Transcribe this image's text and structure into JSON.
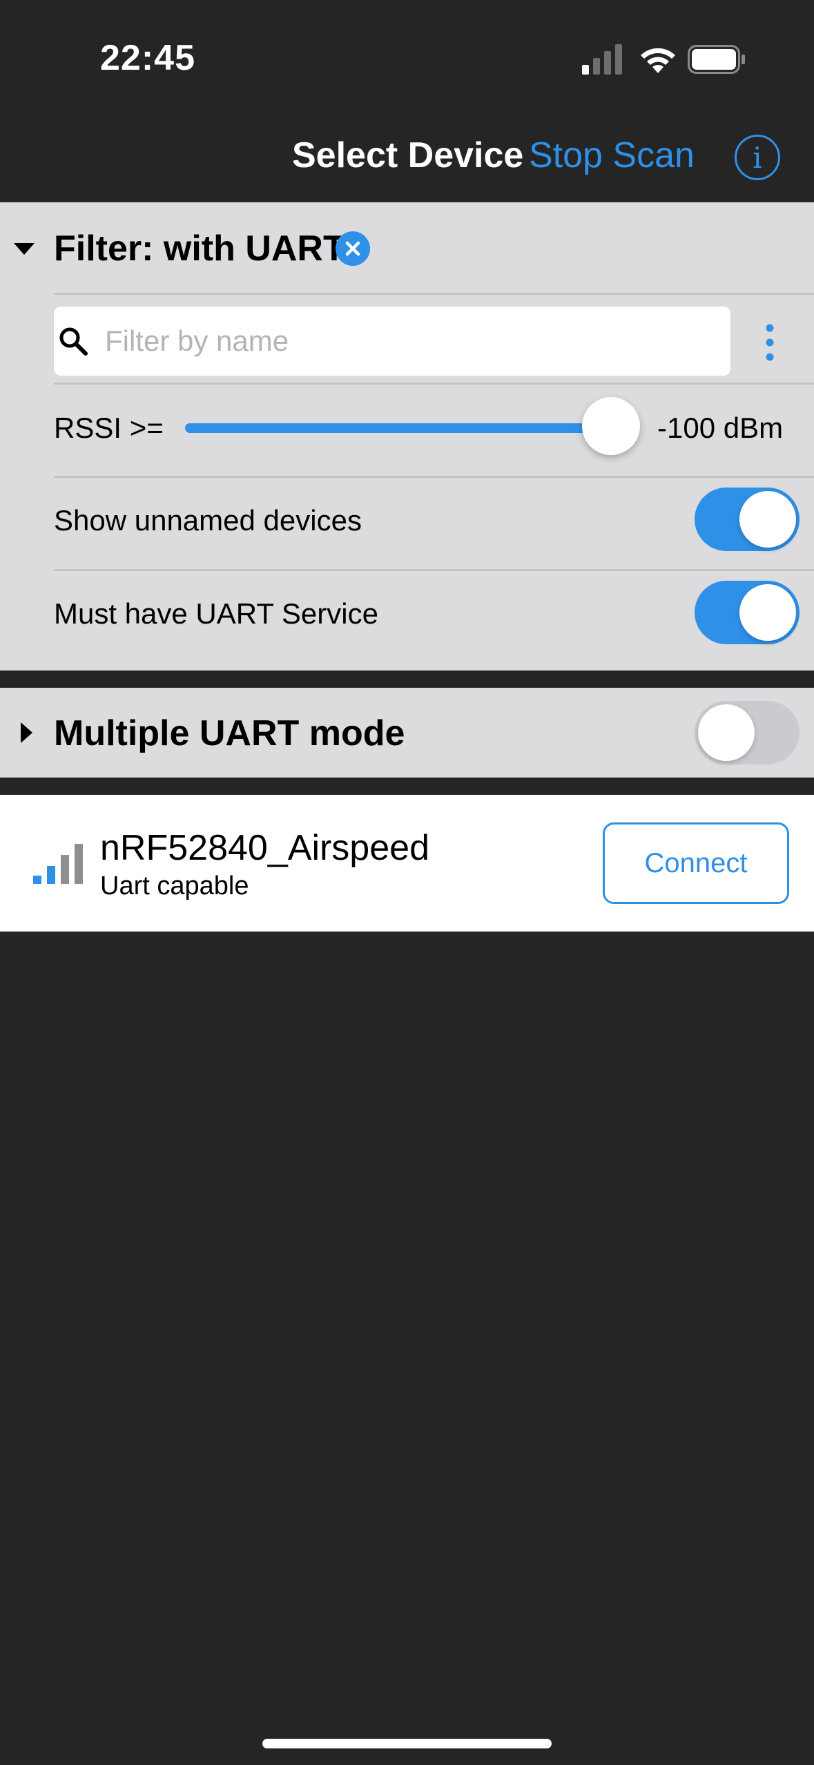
{
  "status_bar": {
    "time": "22:45"
  },
  "nav": {
    "title": "Select Device",
    "stop_scan_label": "Stop Scan",
    "info_icon": "info-icon"
  },
  "filter": {
    "title": "Filter: with UART",
    "search_placeholder": "Filter by name",
    "search_value": "",
    "rssi_label": "RSSI >=",
    "rssi_value": "-100 dBm",
    "rssi_slider_fraction": 1.0,
    "show_unnamed_label": "Show unnamed devices",
    "show_unnamed_on": true,
    "must_have_uart_label": "Must have UART Service",
    "must_have_uart_on": true
  },
  "multiple_uart": {
    "label": "Multiple UART mode",
    "on": false
  },
  "devices": [
    {
      "name": "nRF52840_Airspeed",
      "subtitle": "Uart capable",
      "connect_label": "Connect",
      "signal_bars_active": 2,
      "signal_bars_total": 4
    }
  ],
  "colors": {
    "accent": "#2f90e8",
    "background": "#252525",
    "panel": "#dcdcdf"
  }
}
